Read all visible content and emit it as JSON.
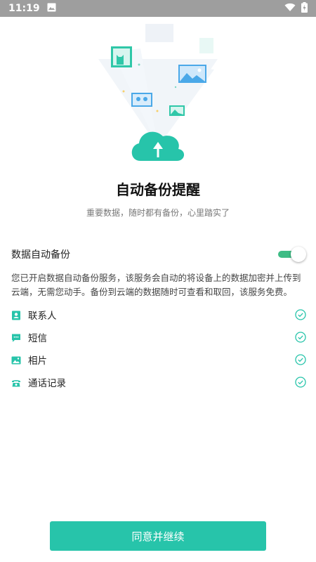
{
  "status_bar": {
    "time": "11:19",
    "gallery_icon": "image-icon",
    "wifi_icon": "wifi-icon",
    "battery_icon": "battery-charging-icon"
  },
  "hero": {
    "illustration": "cloud-upload-illustration",
    "accent_color": "#27c4aa"
  },
  "title": "自动备份提醒",
  "subtitle": "重要数据，随时都有备份，心里踏实了",
  "backup": {
    "label": "数据自动备份",
    "toggle_on": true,
    "toggle_color": "#3ebc85"
  },
  "description": "您已开启数据自动备份服务，该服务会自动的将设备上的数据加密并上传到云端，无需您动手。备份到云端的数据随时可查看和取回，该服务免费。",
  "items": [
    {
      "label": "联系人",
      "icon": "contacts-icon",
      "checked": true
    },
    {
      "label": "短信",
      "icon": "sms-icon",
      "checked": true
    },
    {
      "label": "相片",
      "icon": "photo-icon",
      "checked": true
    },
    {
      "label": "通话记录",
      "icon": "phone-icon",
      "checked": true
    }
  ],
  "continue_button": {
    "label": "同意并继续",
    "color": "#27c4aa"
  }
}
